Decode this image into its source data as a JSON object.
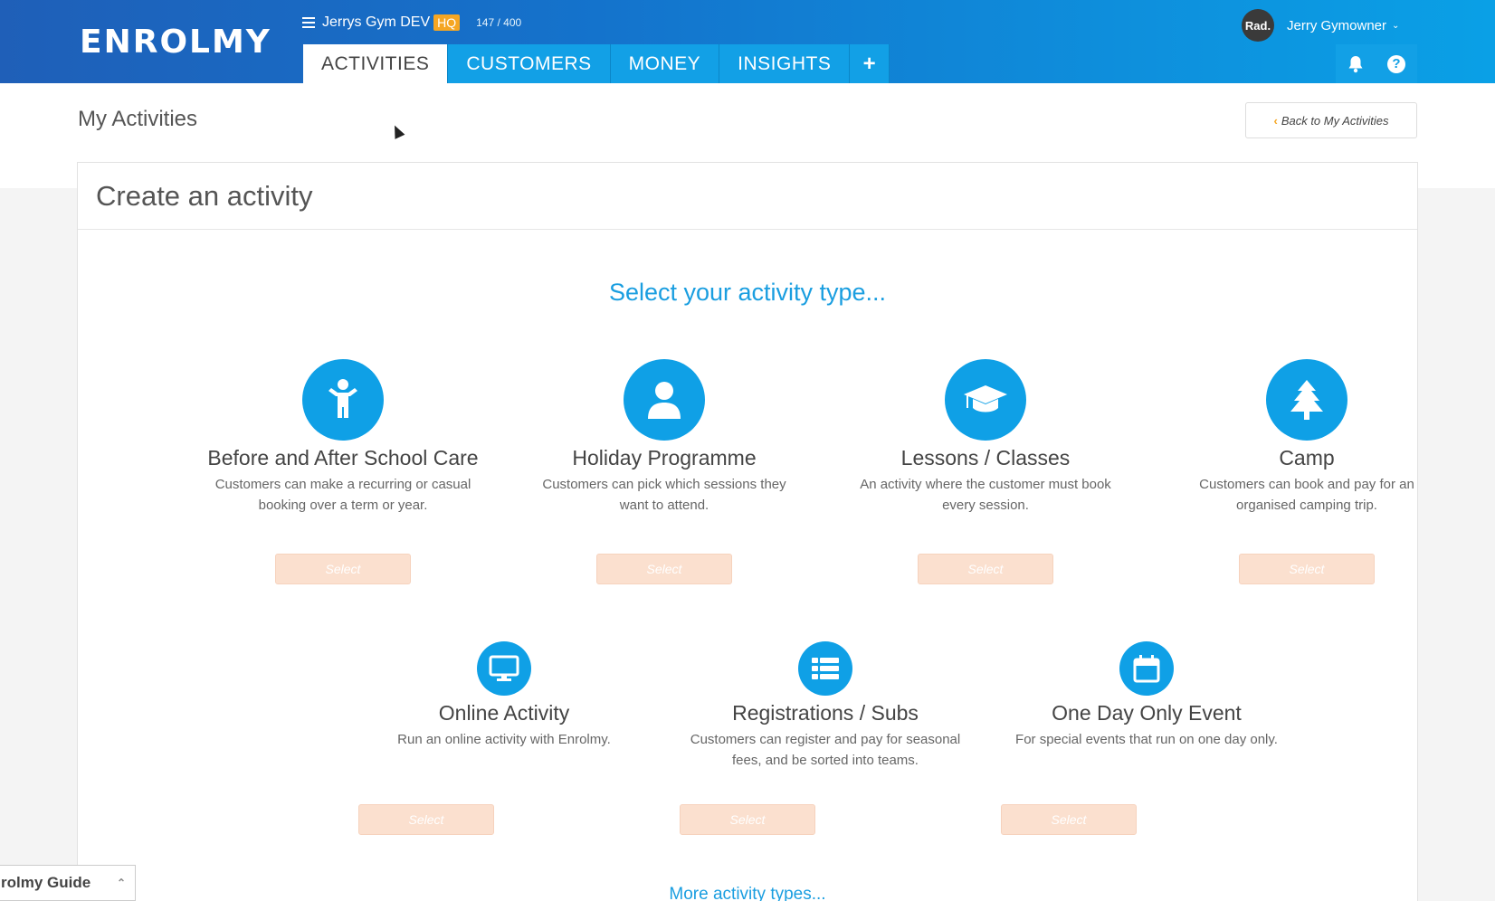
{
  "header": {
    "logo": "ENROLMY",
    "org_name": "Jerrys Gym DEV",
    "org_badge": "HQ",
    "usage": "147 / 400",
    "tabs": [
      {
        "label": "ACTIVITIES"
      },
      {
        "label": "CUSTOMERS"
      },
      {
        "label": "MONEY"
      },
      {
        "label": "INSIGHTS"
      },
      {
        "label": "+"
      }
    ],
    "user": {
      "avatar_text": "Rad.",
      "name": "Jerry Gymowner"
    },
    "icons": [
      "bell-icon",
      "help-icon"
    ]
  },
  "page": {
    "title": "My Activities",
    "back_button": "Back to My Activities"
  },
  "card": {
    "title": "Create an activity",
    "heading": "Select your activity type...",
    "types": [
      {
        "name": "Before and After School Care",
        "desc": "Customers can make a recurring or casual booking over a term or year.",
        "button": "Select",
        "icon": "child-icon"
      },
      {
        "name": "Holiday Programme",
        "desc": "Customers can pick which sessions they want to attend.",
        "button": "Select",
        "icon": "user-icon"
      },
      {
        "name": "Lessons / Classes",
        "desc": "An activity where the customer must book every session.",
        "button": "Select",
        "icon": "graduation-cap-icon"
      },
      {
        "name": "Camp",
        "desc": "Customers can book and pay for an organised camping trip.",
        "button": "Select",
        "icon": "tree-icon"
      },
      {
        "name": "Online Activity",
        "desc": "Run an online activity with Enrolmy.",
        "button": "Select",
        "icon": "monitor-icon"
      },
      {
        "name": "Registrations / Subs",
        "desc": "Customers can register and pay for seasonal fees, and be sorted into teams.",
        "button": "Select",
        "icon": "list-icon"
      },
      {
        "name": "One Day Only Event",
        "desc": "For special events that run on one day only.",
        "button": "Select",
        "icon": "calendar-icon"
      }
    ],
    "more_link": "More activity types..."
  },
  "guide": {
    "label": "rolmy Guide"
  },
  "colors": {
    "accent": "#0fa0e6",
    "header_start": "#1f5fb8",
    "header_end": "#0aa0e6",
    "select_button": "#fbe0cf",
    "badge": "#f5a623"
  }
}
